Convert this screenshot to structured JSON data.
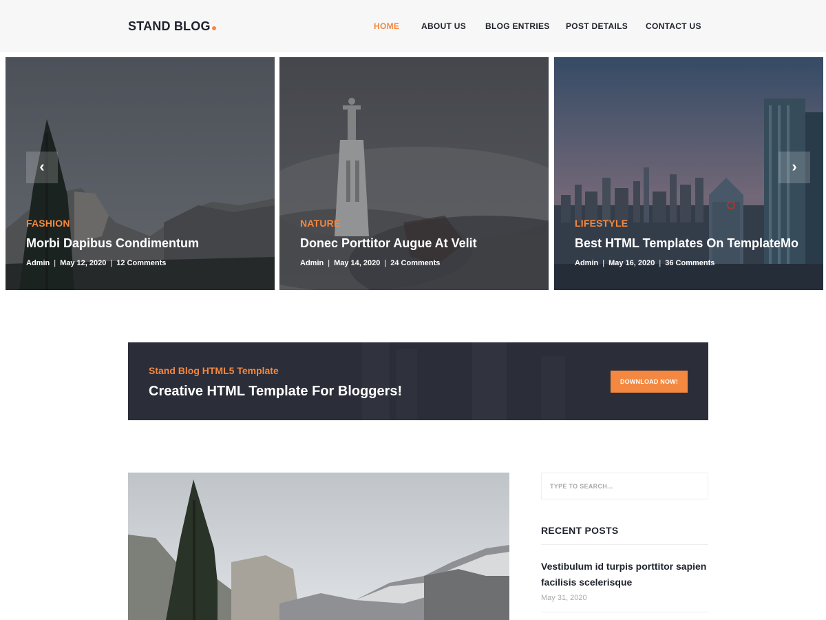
{
  "header": {
    "logo": "STAND BLOG",
    "nav": [
      {
        "label": "HOME",
        "active": true
      },
      {
        "label": "ABOUT US",
        "active": false
      },
      {
        "label": "BLOG ENTRIES",
        "active": false
      },
      {
        "label": "POST DETAILS",
        "active": false
      },
      {
        "label": "CONTACT US",
        "active": false
      }
    ]
  },
  "slider": {
    "prev_icon": "chevron-left-icon",
    "next_icon": "chevron-right-icon",
    "prev_glyph": "‹",
    "next_glyph": "›",
    "slides": [
      {
        "category": "FASHION",
        "title": "Morbi Dapibus Condimentum",
        "author": "Admin",
        "date": "May 12, 2020",
        "comments": "12 Comments"
      },
      {
        "category": "NATURE",
        "title": "Donec Porttitor Augue At Velit",
        "author": "Admin",
        "date": "May 14, 2020",
        "comments": "24 Comments"
      },
      {
        "category": "LIFESTYLE",
        "title": "Best HTML Templates On TemplateMo",
        "author": "Admin",
        "date": "May 16, 2020",
        "comments": "36 Comments"
      }
    ],
    "meta_separator": "|"
  },
  "cta": {
    "subtitle": "Stand Blog HTML5 Template",
    "title": "Creative HTML Template For Bloggers!",
    "button": "DOWNLOAD NOW!"
  },
  "sidebar": {
    "search_placeholder": "TYPE TO SEARCH...",
    "recent_heading": "RECENT POSTS",
    "recent_posts": [
      {
        "title": "Vestibulum id turpis porttitor sapien facilisis scelerisque",
        "date": "May 31, 2020"
      }
    ]
  },
  "colors": {
    "accent": "#f48840",
    "dark": "#20232e",
    "header_bg": "#f7f7f7",
    "cta_bg": "#2b2d38"
  }
}
